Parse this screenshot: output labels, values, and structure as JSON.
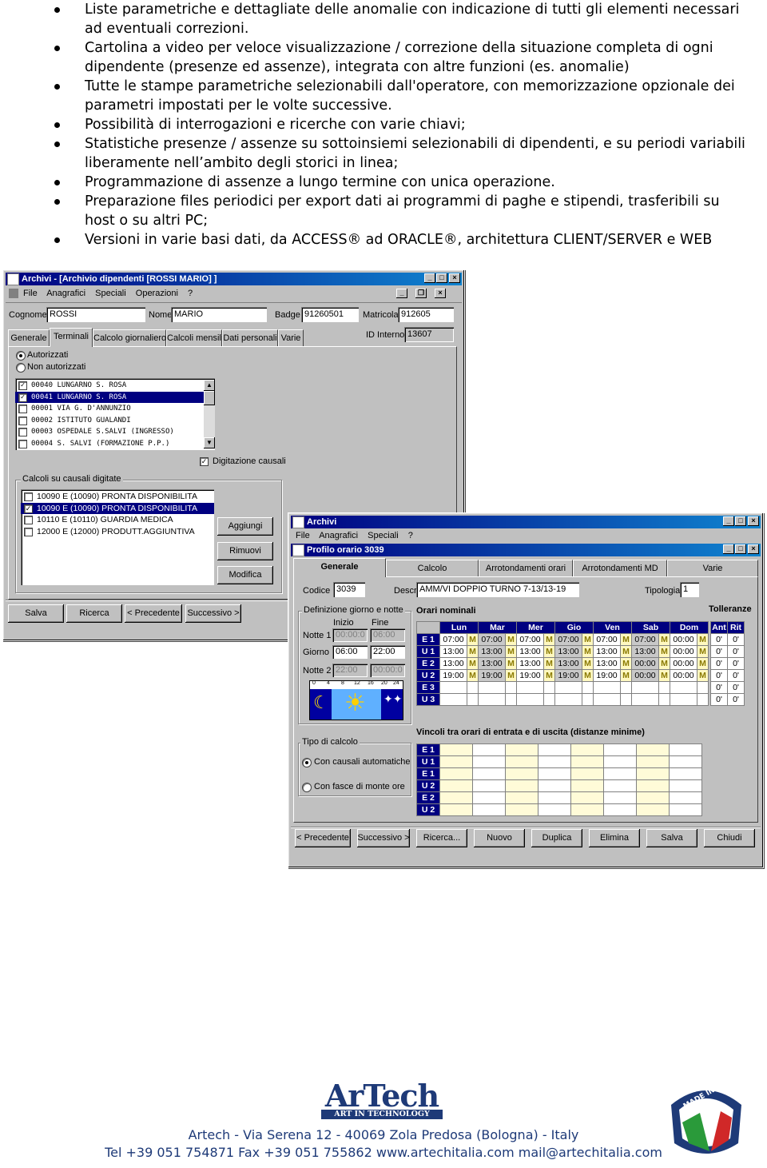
{
  "bullets": [
    "Liste parametriche e dettagliate delle anomalie con indicazione di tutti gli elementi necessari ad eventuali correzioni.",
    "Cartolina a video per veloce visualizzazione / correzione della situazione completa di ogni dipendente (presenze ed assenze), integrata con altre funzioni (es. anomalie)",
    "Tutte le stampe parametriche selezionabili dall'operatore, con memorizzazione opzionale dei parametri impostati per le volte successive.",
    "Possibilità di interrogazioni e ricerche con varie chiavi;",
    "Statistiche presenze / assenze su sottoinsiemi selezionabili di dipendenti, e su periodi variabili liberamente nell’ambito degli storici in linea;",
    "Programmazione di assenze a lungo termine con unica operazione.",
    "Preparazione files periodici per export dati ai programmi di paghe e stipendi, trasferibili su host o su altri PC;",
    "Versioni in varie basi dati, da ACCESS® ad ORACLE®, architettura CLIENT/SERVER e WEB"
  ],
  "win1": {
    "title": "Archivi - [Archivio dipendenti [ROSSI MARIO] ]",
    "menu": [
      "File",
      "Anagrafici",
      "Speciali",
      "Operazioni",
      "?"
    ],
    "cognome_label": "Cognome",
    "cognome": "ROSSI",
    "nome_label": "Nome",
    "nome": "MARIO",
    "badge_label": "Badge",
    "badge": "91260501",
    "matricola_label": "Matricola",
    "matricola": "912605",
    "id_label": "ID Interno",
    "id": "13607",
    "tabs": [
      "Generale",
      "Terminali",
      "Calcolo giornaliero",
      "Calcoli mensili",
      "Dati personali",
      "Varie"
    ],
    "radio_autorizzati": "Autorizzati",
    "radio_non_autorizzati": "Non autorizzati",
    "terminals": [
      {
        "label": "00040 LUNGARNO S. ROSA",
        "checked": true,
        "selected": false
      },
      {
        "label": "00041 LUNGARNO S. ROSA",
        "checked": true,
        "selected": true
      },
      {
        "label": "00001 VIA G. D'ANNUNZIO",
        "checked": false,
        "selected": false
      },
      {
        "label": "00002 ISTITUTO GUALANDI",
        "checked": false,
        "selected": false
      },
      {
        "label": "00003 OSPEDALE S.SALVI (INGRESSO)",
        "checked": false,
        "selected": false
      },
      {
        "label": "00004 S. SALVI   (FORMAZIONE P.P.)",
        "checked": false,
        "selected": false
      }
    ],
    "digitazione_causali": "Digitazione causali",
    "group_calcoli": "Calcoli su causali digitate",
    "causali": [
      {
        "label": "10090 E (10090) PRONTA DISPONIBILITA",
        "checked": false,
        "selected": false
      },
      {
        "label": "10090 E (10090) PRONTA DISPONIBILITA",
        "checked": true,
        "selected": true
      },
      {
        "label": "10110 E (10110) GUARDIA MEDICA",
        "checked": false,
        "selected": false
      },
      {
        "label": "12000 E (12000) PRODUTT.AGGIUNTIVA",
        "checked": false,
        "selected": false
      }
    ],
    "btn_aggiungi": "Aggiungi",
    "btn_rimuovi": "Rimuovi",
    "btn_modifica": "Modifica",
    "btn_salva": "Salva",
    "btn_ricerca": "Ricerca",
    "btn_precedente": "< Precedente",
    "btn_successivo": "Successivo >"
  },
  "win2": {
    "title": "Archivi",
    "menu": [
      "File",
      "Anagrafici",
      "Speciali",
      "?"
    ],
    "sub_title": "Profilo orario 3039",
    "tabs": [
      "Generale",
      "Calcolo",
      "Arrotondamenti orari",
      "Arrotondamenti MD",
      "Varie"
    ],
    "codice_label": "Codice",
    "codice": "3039",
    "descrizione_label": "Descrizione",
    "descrizione": "AMM/VI DOPPIO TURNO 7-13/13-19",
    "tipologia_label": "Tipologia",
    "tipologia": "1",
    "def_title": "Definizione giorno e notte",
    "inizio_label": "Inizio",
    "fine_label": "Fine",
    "notte1_label": "Notte 1",
    "notte1_inizio": "00:00:0",
    "notte1_fine": "06:00",
    "giorno_label": "Giorno",
    "giorno_inizio": "06:00",
    "giorno_fine": "22:00",
    "notte2_label": "Notte 2",
    "notte2_inizio": "22:00",
    "notte2_fine": "00:00:0",
    "dial_ticks": [
      "0",
      "4",
      "8",
      "12",
      "16",
      "20",
      "24"
    ],
    "orari_title": "Orari nominali",
    "days": [
      "Lun",
      "Mar",
      "Mer",
      "Gio",
      "Ven",
      "Sab",
      "Dom"
    ],
    "rows": [
      {
        "label": "E 1",
        "cells": [
          "07:00",
          "07:00",
          "07:00",
          "07:00",
          "07:00",
          "07:00",
          "00:00"
        ]
      },
      {
        "label": "U 1",
        "cells": [
          "13:00",
          "13:00",
          "13:00",
          "13:00",
          "13:00",
          "13:00",
          "00:00"
        ]
      },
      {
        "label": "E 2",
        "cells": [
          "13:00",
          "13:00",
          "13:00",
          "13:00",
          "13:00",
          "00:00",
          "00:00"
        ]
      },
      {
        "label": "U 2",
        "cells": [
          "19:00",
          "19:00",
          "19:00",
          "19:00",
          "19:00",
          "00:00",
          "00:00"
        ]
      },
      {
        "label": "E 3",
        "cells": [
          "",
          "",
          "",
          "",
          "",
          "",
          ""
        ]
      },
      {
        "label": "U 3",
        "cells": [
          "",
          "",
          "",
          "",
          "",
          "",
          ""
        ]
      }
    ],
    "m_mark": "M",
    "toll_title": "Tolleranze",
    "toll_headers": [
      "Ant",
      "Rit"
    ],
    "toll_rows": [
      [
        "0'",
        "0'"
      ],
      [
        "0'",
        "0'"
      ],
      [
        "0'",
        "0'"
      ],
      [
        "0'",
        "0'"
      ],
      [
        "0'",
        "0'"
      ],
      [
        "0'",
        "0'"
      ]
    ],
    "tipo_title": "Tipo di calcolo",
    "radio_causali": "Con causali automatiche",
    "radio_fasce": "Con fasce di monte ore",
    "vincoli_title": "Vincoli tra orari di entrata e di uscita (distanze minime)",
    "vincoli_rows": [
      "E 1",
      "U 1",
      "E 1",
      "U 2",
      "E 2",
      "U 2"
    ],
    "buttons": [
      "< Precedente",
      "Successivo >",
      "Ricerca...",
      "Nuovo",
      "Duplica",
      "Elimina",
      "Salva",
      "Chiudi"
    ]
  },
  "footer": {
    "logo_main": "ArTech",
    "logo_sub": "ART IN TECHNOLOGY",
    "badge_text": "MADE IN ITALY",
    "line1": "Artech  -  Via Serena 12  -  40069 Zola Predosa (Bologna)  -  Italy",
    "line2": "Tel +39 051 754871   Fax +39 051 755862   www.artechitalia.com    mail@artechitalia.com"
  }
}
